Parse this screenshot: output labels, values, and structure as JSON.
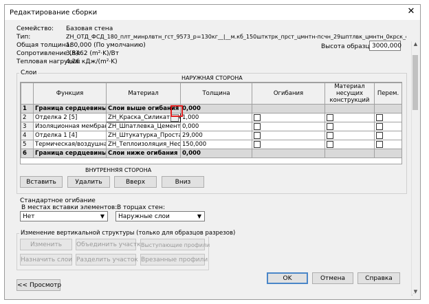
{
  "window": {
    "title": "Редактирование сборки",
    "close_glyph": "✕"
  },
  "info": {
    "family_label": "Семейство:",
    "family_value": "Базовая стена",
    "type_label": "Тип:",
    "type_value": "ZH_ОТД_ФСД_180_плт_минрлвтн_гст_9573_р=130кг__|__м.кб_150штктрк_прст_цмнтн-псчн_29шптлвк_цмнтн_0крск_слктн_1 2",
    "thickness_label": "Общая толщина:",
    "thickness_value": "180,000 (По умолчанию)",
    "resistance_label": "Сопротивление (R):",
    "resistance_value": "3,8462 (m²·K)/Вт",
    "thermal_label": "Тепловая нагрузка:",
    "thermal_value": "4,26 кДж/(m²·K)",
    "sample_height_label": "Высота образца:",
    "sample_height_value": "3000,000"
  },
  "layers": {
    "group_label": "Слои",
    "exterior_label": "НАРУЖНАЯ СТОРОНА",
    "interior_label": "ВНУТРЕННЯЯ СТОРОНА",
    "columns": [
      "",
      "Функция",
      "Материал",
      "Толщина",
      "Огибания",
      "Материал несущих конструкций",
      "Перем."
    ],
    "rows": [
      {
        "num": "1",
        "function": "Граница сердцевины",
        "material": "Слои выше огибания",
        "thickness": "0,000",
        "bold": true
      },
      {
        "num": "2",
        "function": "Отделка 2 [5]",
        "material": "ZH_Краска_Силикатная",
        "thickness": "1,000",
        "bold": false
      },
      {
        "num": "3",
        "function": "Изоляционная мембрана",
        "material": "ZH_Шпатлевка_Цементн",
        "thickness": "0,000",
        "bold": false
      },
      {
        "num": "4",
        "function": "Отделка 1 [4]",
        "material": "ZH_Штукатурка_Простая",
        "thickness": "29,000",
        "bold": false
      },
      {
        "num": "5",
        "function": "Термическая/воздушная п",
        "material": "ZH_Теплоизоляция_Нео",
        "thickness": "150,000",
        "bold": false
      },
      {
        "num": "6",
        "function": "Граница сердцевины",
        "material": "Слои ниже огибания",
        "thickness": "0,000",
        "bold": true
      }
    ],
    "buttons": {
      "insert": "Вставить",
      "delete": "Удалить",
      "up": "Вверх",
      "down": "Вниз"
    }
  },
  "wrapping": {
    "group_label": "Стандартное огибание",
    "insert_label": "В местах вставки элементов:",
    "insert_value": "Нет",
    "ends_label": "В торцах стен:",
    "ends_value": "Наружные слои"
  },
  "vertical": {
    "group_label": "Изменение вертикальной структуры (только для образцов разрезов)",
    "modify": "Изменить",
    "merge": "Объединить участки",
    "sweeps": "Выступающие профили",
    "assign": "Назначить слои",
    "split": "Разделить участок",
    "reveals": "Врезанные профили"
  },
  "footer": {
    "preview": "<< Просмотр",
    "ok": "OK",
    "cancel": "Отмена",
    "help": "Справка"
  }
}
